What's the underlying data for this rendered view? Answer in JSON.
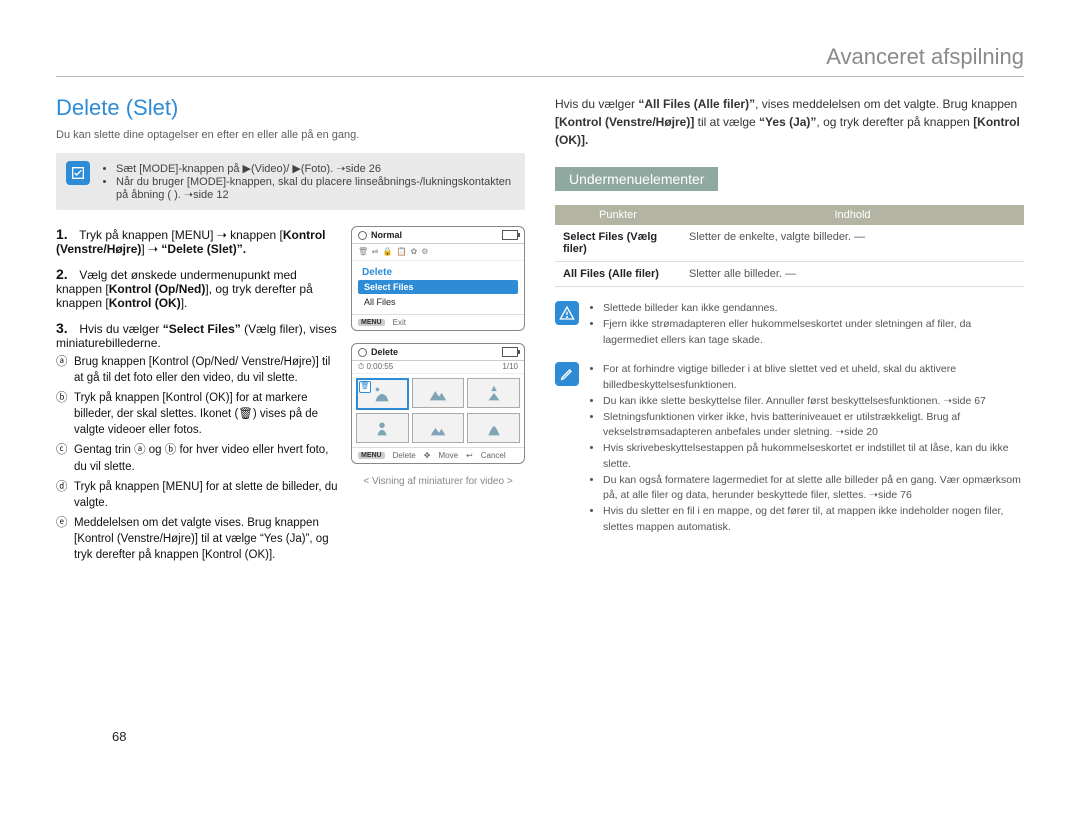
{
  "header_right": "Avanceret afspilning",
  "title": "Delete (Slet)",
  "intro": "Du kan slette dine optagelser en efter en eller alle på en gang.",
  "note1_lines": [
    "Sæt [MODE]‑knappen på ▶(Video)/ ▶(Foto). ➝side 26",
    "Når du bruger [MODE]‑knappen, skal du placere linseåbnings-/lukningskontakten på åbning ( ). ➝side 12"
  ],
  "step1_a": "Tryk på knappen [MENU]",
  "step1_b": "Kontrol (Venstre/Højre)",
  "step1_c": "“Delete (Slet)”.",
  "step2_a": "Vælg det ønskede undermenupunkt med knappen",
  "step2_b": "Kontrol (Op/Ned)",
  "step2_c": ", og tryk derefter på knappen",
  "step2_d": "Kontrol (OK)",
  "step3_a": "Hvis du vælger",
  "step3_b": "“Select Files”",
  "step3_c": " (Vælg filer), vises miniaturebillederne.",
  "sub_a": "Brug knappen [Kontrol (Op/Ned/ Venstre/Højre)] til at gå til det foto eller den video, du vil slette.",
  "sub_b": "Tryk på knappen [Kontrol (OK)] for at markere billeder, der skal slettes. Ikonet (🗑) vises på de valgte videoer eller fotos.",
  "sub_c": "Gentag trin ⓐ og ⓑ for hver video eller hvert foto, du vil slette.",
  "sub_d": "Tryk på knappen [MENU] for at slette de billeder, du valgte.",
  "sub_e": "Meddelelsen om det valgte vises. Brug knappen [Kontrol (Venstre/Højre)] til at vælge “Yes (Ja)”, og tryk derefter på knappen [Kontrol (OK)].",
  "step3_alt_a": "Hvis du vælger ",
  "step3_alt_b": "“All Files (Alle filer)”",
  "step3_alt_c": ", vises meddelelsen om det valgte. Brug knappen",
  "step3_alt_d": "[Kontrol (Venstre/Højre)]",
  "step3_alt_e": " til at vælge ",
  "step3_alt_f": "“Yes (Ja)”",
  "step3_alt_g": ", og tryk derefter på knappen ",
  "step3_alt_h": "[Kontrol (OK)].",
  "screen1": {
    "top": "Normal",
    "menu_title": "Delete",
    "items": [
      "Select Files",
      "All Files"
    ],
    "footer": "Exit"
  },
  "screen2": {
    "top": "Delete",
    "time": "0:00:55",
    "count": "1/10",
    "footer": [
      "Delete",
      "Move",
      "Cancel"
    ]
  },
  "caption": "< Visning af miniaturer for video >",
  "submenu_band": "Undermenuelementer",
  "table": {
    "headers": [
      "Punkter",
      "Indhold"
    ],
    "rows": [
      [
        "Select Files (Vælg filer)",
        "Sletter de enkelte, valgte billeder. —"
      ],
      [
        "All Files (Alle filer)",
        "Sletter alle billeder. —"
      ]
    ]
  },
  "warn_lines": [
    "Slettede billeder kan ikke gendannes.",
    "Fjern ikke strømadapteren eller hukommelseskortet under sletningen af filer, da lagermediet ellers kan tage skade."
  ],
  "info_lines": [
    "For at forhindre vigtige billeder i at blive slettet ved et uheld, skal du aktivere billedbeskyttelsesfunktionen.",
    "Du kan ikke slette beskyttelse filer. Annuller først beskyttelsesfunktionen. ➝side 67",
    "Sletningsfunktionen virker ikke, hvis batteriniveauet er utilstrækkeligt. Brug af vekselstrømsadapteren anbefales under sletning. ➝side 20",
    "Hvis skrivebeskyttelsestappen på hukommelseskortet er indstillet til at låse, kan du ikke slette.",
    "Du kan også formatere lagermediet for at slette alle billeder på en gang. Vær opmærksom på, at alle filer og data, herunder beskyttede filer, slettes. ➝side 76",
    "Hvis du sletter en fil i en mappe, og det fører til, at mappen ikke indeholder nogen filer, slettes mappen automatisk."
  ],
  "page_number": "68"
}
